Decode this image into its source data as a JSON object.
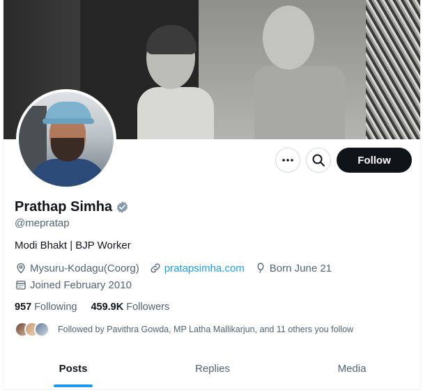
{
  "profile": {
    "name": "Prathap Simha",
    "handle": "@mepratap",
    "bio": "Modi Bhakt | BJP Worker",
    "location": "Mysuru-Kodagu(Coorg)",
    "website": "pratapsimha.com",
    "birthday": "Born June 21",
    "joined": "Joined February 2010",
    "verified_color": "#829aab"
  },
  "actions": {
    "follow_label": "Follow",
    "more_icon": "more-icon",
    "search_icon": "search-icon"
  },
  "stats": {
    "following_count": "957",
    "following_label": "Following",
    "followers_count": "459.9K",
    "followers_label": "Followers"
  },
  "followed_by": {
    "text": "Followed by Pavithra Gowda, MP Latha Mallikarjun, and 11 others you follow"
  },
  "tabs": [
    {
      "label": "Posts",
      "active": true
    },
    {
      "label": "Replies",
      "active": false
    },
    {
      "label": "Media",
      "active": false
    }
  ],
  "colors": {
    "accent": "#1d9bf0",
    "text_primary": "#0f1419",
    "text_secondary": "#536471",
    "follow_button": "#0f1419"
  }
}
